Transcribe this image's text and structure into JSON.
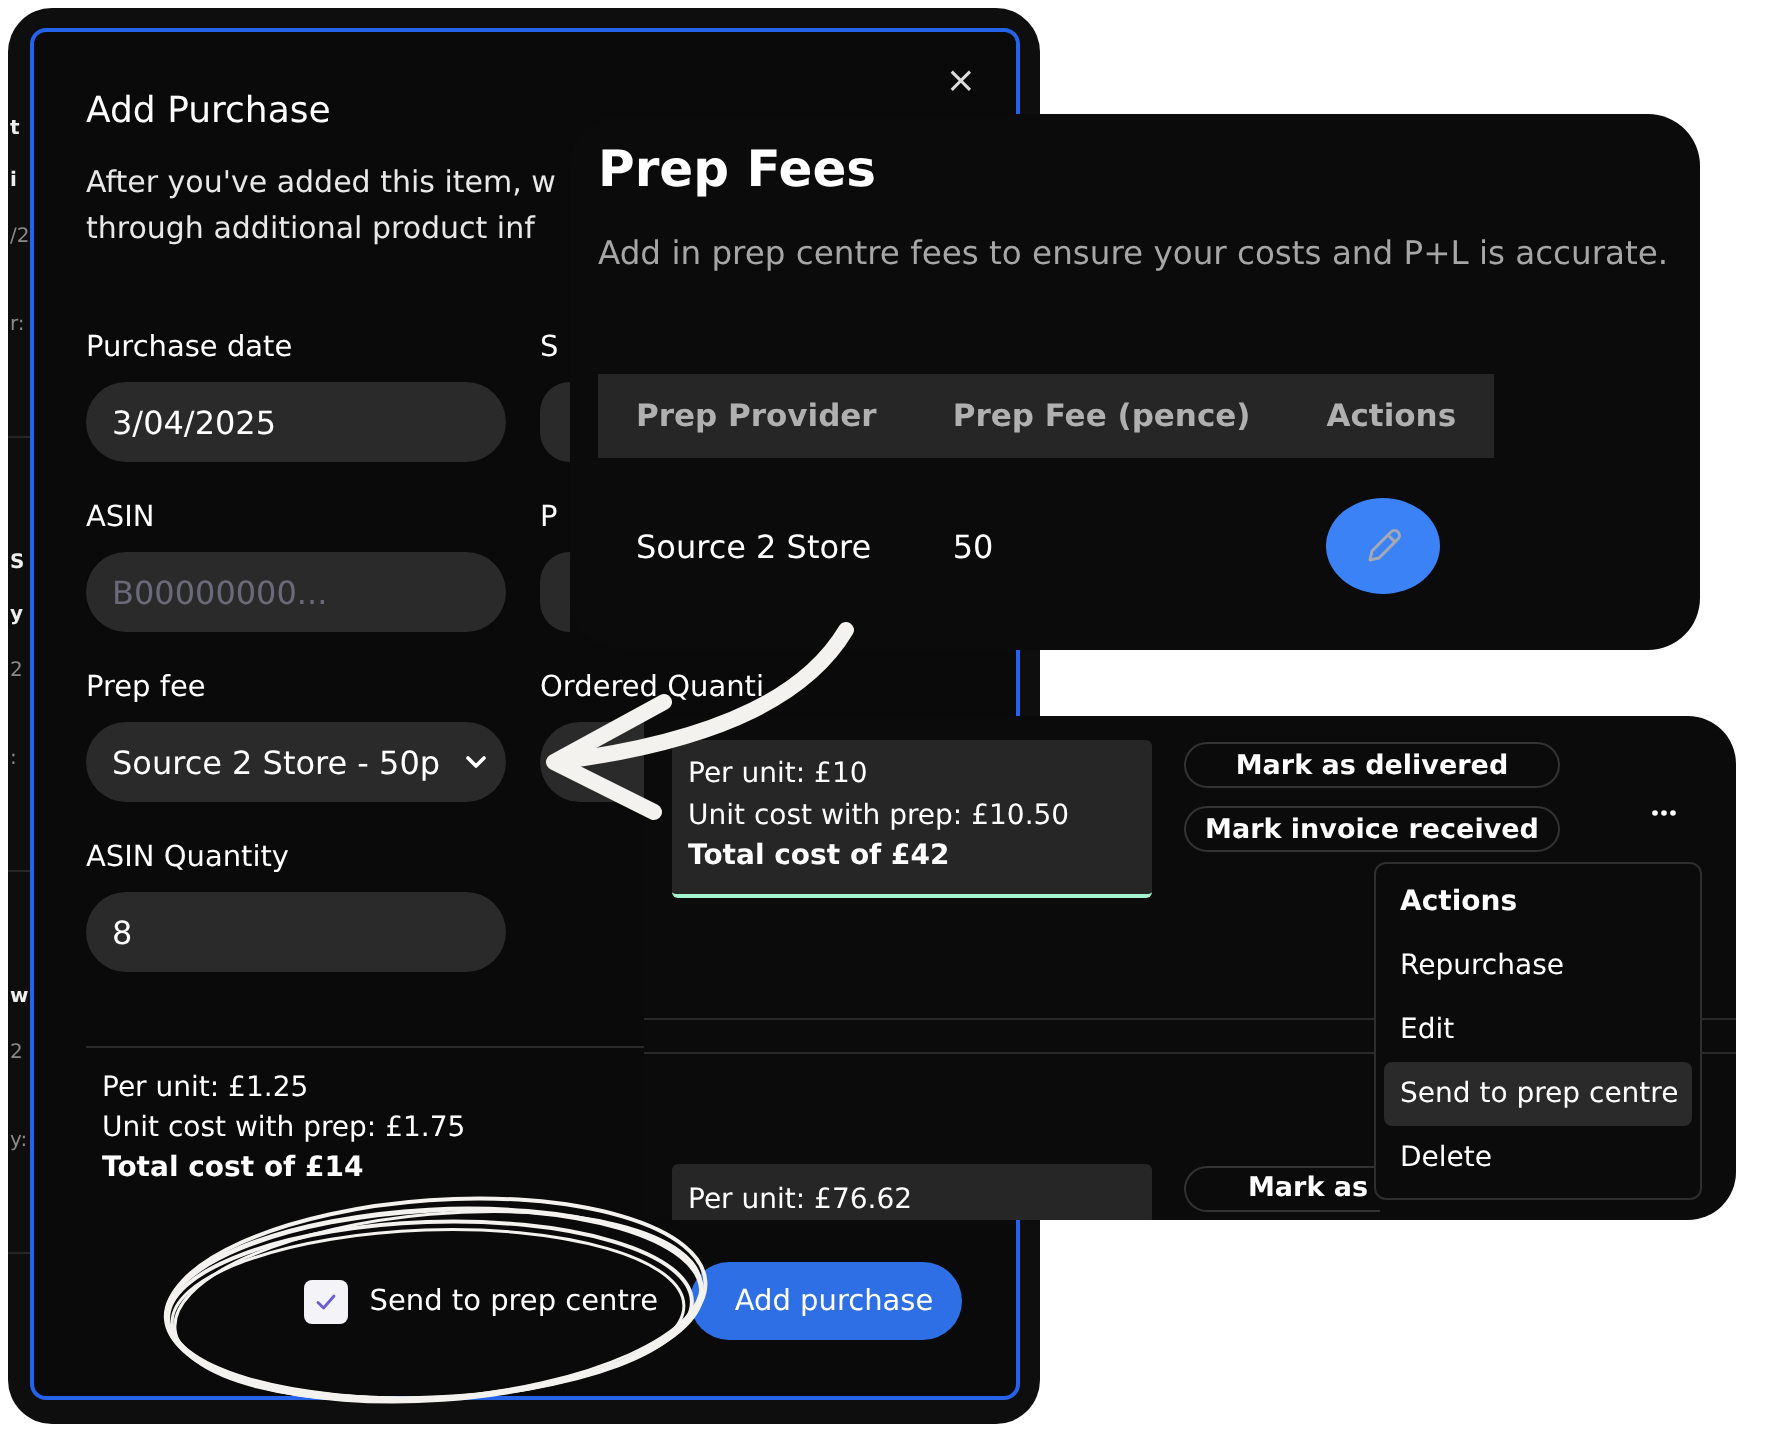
{
  "background_list": [
    {
      "lines": [
        {
          "text": "t",
          "kind": "title"
        },
        {
          "text": "i",
          "kind": "title"
        },
        {
          "text": "/2",
          "kind": "meta"
        },
        {
          "text": "r:",
          "kind": "meta"
        }
      ]
    },
    {
      "lines": [
        {
          "text": "S",
          "kind": "title"
        },
        {
          "text": "y",
          "kind": "title"
        },
        {
          "text": "2",
          "kind": "meta"
        },
        {
          "text": ":",
          "kind": "meta"
        }
      ]
    },
    {
      "lines": [
        {
          "text": "w",
          "kind": "title"
        },
        {
          "text": "2",
          "kind": "meta"
        },
        {
          "text": "y:",
          "kind": "meta"
        }
      ]
    }
  ],
  "add_purchase_modal": {
    "title": "Add Purchase",
    "close": "×",
    "description_lines": [
      "After you've added this item, w",
      "through additional product inf"
    ],
    "fields": [
      {
        "label": "Purchase date",
        "kind": "input",
        "value": "3/04/2025"
      },
      {
        "label": "S",
        "kind": "covered"
      },
      {
        "label": "ASIN",
        "kind": "input",
        "placeholder": "B00000000..."
      },
      {
        "label": "P",
        "kind": "covered"
      },
      {
        "label": "Prep fee",
        "kind": "select",
        "value": "Source 2 Store - 50p"
      },
      {
        "label": "Ordered Quanti",
        "kind": "covered"
      },
      {
        "label": "ASIN Quantity",
        "kind": "input",
        "value": "8"
      }
    ],
    "summary": [
      "Per unit: £1.25",
      "Unit cost with prep: £1.75"
    ],
    "total": "Total cost of £14",
    "send_to_prep_centre": {
      "label": "Send to prep centre",
      "checked": true
    },
    "submit_button": "Add purchase"
  },
  "prep_fees_card": {
    "title": "Prep Fees",
    "subtitle": "Add in prep centre fees to ensure your costs and P+L is accurate.",
    "columns": [
      "Prep Provider",
      "Prep Fee (pence)",
      "Actions"
    ],
    "rows": [
      {
        "provider": "Source 2 Store",
        "fee": "50"
      }
    ]
  },
  "purchases_panel": {
    "rows": [
      {
        "summary": [
          "Per unit: £10",
          "Unit cost with prep: £10.50"
        ],
        "total": "Total cost of £42",
        "buttons": [
          "Mark as delivered",
          "Mark invoice received"
        ],
        "more_button": true
      },
      {
        "summary": [
          "Per unit: £76.62"
        ],
        "buttons": [
          "Mark as"
        ],
        "more_button": false
      }
    ],
    "actions_menu": {
      "title": "Actions",
      "items": [
        {
          "label": "Repurchase",
          "selected": false
        },
        {
          "label": "Edit",
          "selected": false
        },
        {
          "label": "Send to prep centre",
          "selected": true
        },
        {
          "label": "Delete",
          "selected": false
        }
      ]
    }
  }
}
